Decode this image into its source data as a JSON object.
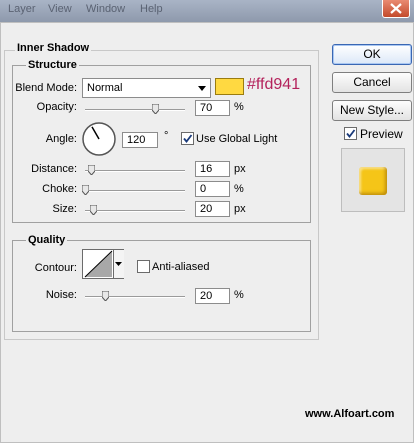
{
  "menubar": {
    "items": [
      "Layer",
      "View",
      "Window",
      "Help"
    ]
  },
  "inner_shadow": {
    "title": "Inner Shadow",
    "structure": {
      "title": "Structure",
      "blend_mode_label": "Blend Mode:",
      "blend_mode_value": "Normal",
      "color_hex": "#ffd941",
      "color_label": "#ffd941",
      "opacity_label": "Opacity:",
      "opacity_value": "70",
      "opacity_unit": "%",
      "opacity_level": 0.7,
      "angle_label": "Angle:",
      "angle_value": "120",
      "angle_unit": "°",
      "use_global_light_label": "Use Global Light",
      "use_global_light_checked": true,
      "distance_label": "Distance:",
      "distance_value": "16",
      "distance_unit": "px",
      "distance_level": 0.06,
      "choke_label": "Choke:",
      "choke_value": "0",
      "choke_unit": "%",
      "choke_level": 0.0,
      "size_label": "Size:",
      "size_value": "20",
      "size_unit": "px",
      "size_level": 0.08
    },
    "quality": {
      "title": "Quality",
      "contour_label": "Contour:",
      "anti_aliased_label": "Anti-aliased",
      "anti_aliased_checked": false,
      "noise_label": "Noise:",
      "noise_value": "20",
      "noise_unit": "%",
      "noise_level": 0.2
    }
  },
  "side": {
    "ok_label": "OK",
    "cancel_label": "Cancel",
    "new_style_label": "New Style...",
    "preview_label": "Preview",
    "preview_checked": true,
    "preview_color": "#f5c518"
  },
  "watermark": "www.Alfoart.com"
}
